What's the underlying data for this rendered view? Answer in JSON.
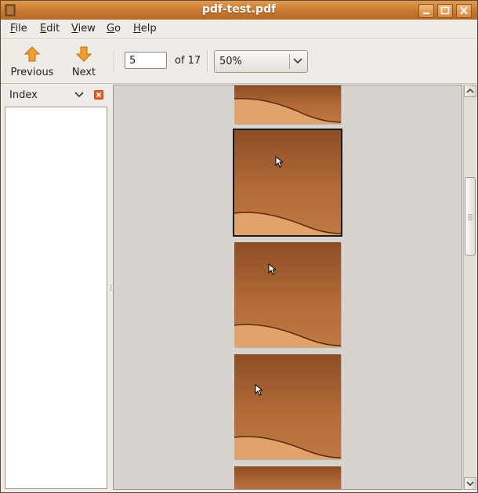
{
  "window": {
    "title": "pdf-test.pdf"
  },
  "menubar": {
    "items": [
      {
        "label": "File",
        "mnemonic": "F",
        "rest": "ile"
      },
      {
        "label": "Edit",
        "mnemonic": "E",
        "rest": "dit"
      },
      {
        "label": "View",
        "mnemonic": "V",
        "rest": "iew"
      },
      {
        "label": "Go",
        "mnemonic": "G",
        "rest": "o"
      },
      {
        "label": "Help",
        "mnemonic": "H",
        "rest": "elp"
      }
    ]
  },
  "toolbar": {
    "previous_label": "Previous",
    "next_label": "Next",
    "page_number": "5",
    "page_count_label": "of 17",
    "zoom_value": "50%"
  },
  "sidebar": {
    "title": "Index"
  },
  "colors": {
    "titlebar": "#c8772f",
    "accent": "#e58a2c",
    "page_brown": "#a25f33"
  }
}
